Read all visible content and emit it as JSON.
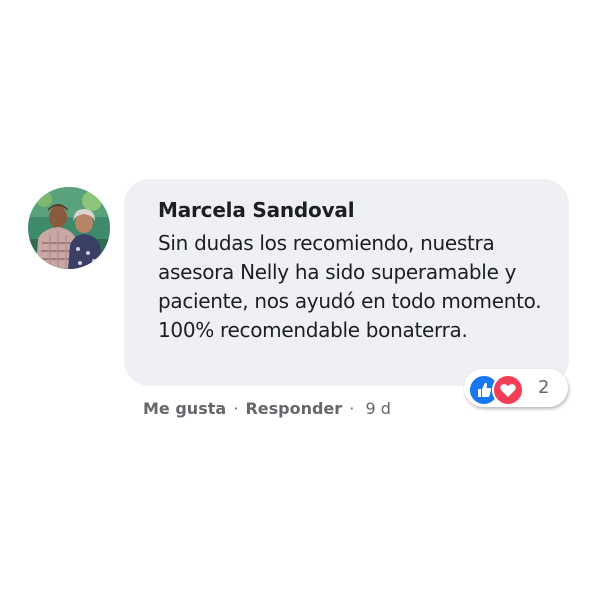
{
  "comment": {
    "author": "Marcela Sandoval",
    "text": "Sin dudas los recomiendo, nuestra asesora Nelly ha sido superamable y paciente, nos ayudó en todo momento. 100% recomendable bonaterra.",
    "avatar_icon": "profile-photo-couple"
  },
  "reactions": {
    "types": [
      "like",
      "love"
    ],
    "count": "2",
    "like_color": "#1877f2",
    "love_color": "#f33e58"
  },
  "actions": {
    "like_label": "Me gusta",
    "separator_1": "·",
    "reply_label": "Responder",
    "separator_2": "·",
    "timestamp": "9 d"
  },
  "colors": {
    "bubble_bg": "#eef0f3",
    "text": "#1c1e21",
    "secondary_text": "#65676b"
  }
}
